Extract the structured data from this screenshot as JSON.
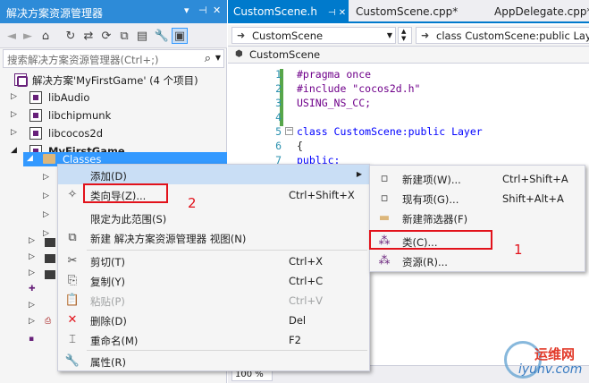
{
  "solution_explorer": {
    "title": "解决方案资源管理器",
    "title_controls": [
      "▾",
      "⊣",
      "✕"
    ],
    "search_placeholder": "搜索解决方案资源管理器(Ctrl+;)",
    "tree": [
      {
        "label": "解决方案'MyFirstGame' (4 个项目)"
      },
      {
        "label": "libAudio"
      },
      {
        "label": "libchipmunk"
      },
      {
        "label": "libcocos2d"
      },
      {
        "label": "MyFirstGame"
      },
      {
        "label": "Classes"
      }
    ]
  },
  "editor": {
    "tabs": [
      {
        "label": "CustomScene.h",
        "extra": "⊣ ✕"
      },
      {
        "label": "CustomScene.cpp*"
      },
      {
        "label": "AppDelegate.cpp*"
      }
    ],
    "scope_combo": "CustomScene",
    "member_combo": "class CustomScene:public Lay",
    "crumb": "CustomScene",
    "line_numbers": [
      "1",
      "2",
      "3",
      "4",
      "5",
      "6",
      "7"
    ],
    "code_lines": [
      [
        "#pragma once"
      ],
      [
        "#include \"cocos2d.h\""
      ],
      [
        "USING_NS_CC;"
      ],
      [
        ""
      ],
      [
        "class CustomScene:public Layer"
      ],
      [
        "{"
      ],
      [
        "public:"
      ]
    ],
    "zoom": "100 %"
  },
  "context_menu": {
    "items": [
      {
        "label": "添加(D)",
        "shortcut": "",
        "submenu": true
      },
      {
        "label": "类向导(Z)...",
        "shortcut": "Ctrl+Shift+X"
      },
      {
        "label": "限定为此范围(S)",
        "shortcut": ""
      },
      {
        "label": "新建 解决方案资源管理器 视图(N)",
        "shortcut": ""
      },
      {
        "label": "剪切(T)",
        "shortcut": "Ctrl+X"
      },
      {
        "label": "复制(Y)",
        "shortcut": "Ctrl+C"
      },
      {
        "label": "粘贴(P)",
        "shortcut": "Ctrl+V",
        "disabled": true
      },
      {
        "label": "删除(D)",
        "shortcut": "Del"
      },
      {
        "label": "重命名(M)",
        "shortcut": "F2"
      },
      {
        "label": "属性(R)",
        "shortcut": ""
      }
    ]
  },
  "submenu": {
    "items": [
      {
        "label": "新建项(W)...",
        "shortcut": "Ctrl+Shift+A"
      },
      {
        "label": "现有项(G)...",
        "shortcut": "Shift+Alt+A"
      },
      {
        "label": "新建筛选器(F)",
        "shortcut": ""
      },
      {
        "label": "类(C)...",
        "shortcut": ""
      },
      {
        "label": "资源(R)...",
        "shortcut": ""
      }
    ]
  },
  "annotations": {
    "one": "1",
    "two": "2"
  },
  "watermark": {
    "cn": "运维网",
    "en": "iyunv.com"
  },
  "colors": {
    "accent": "#007acc",
    "title_bar": "#2d8bd8",
    "highlight": "#c9def5",
    "annotation": "#e2121b"
  }
}
